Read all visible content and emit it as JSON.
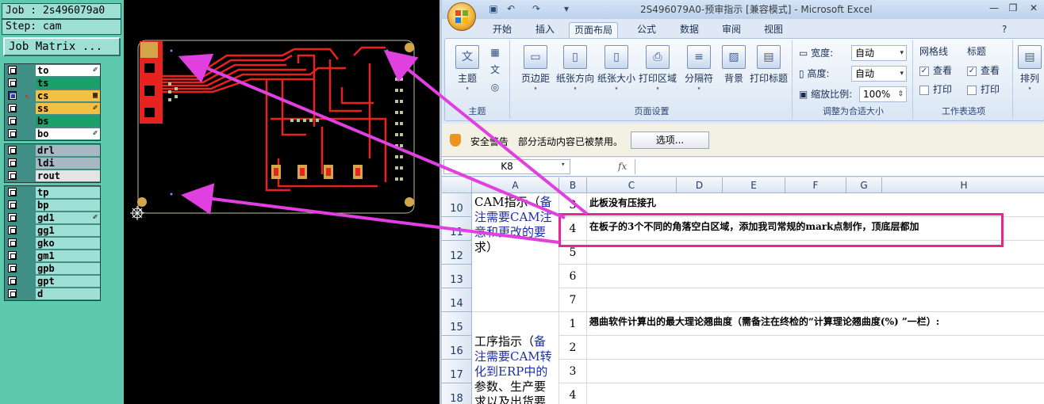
{
  "cam": {
    "job_label": "Job : 2s496079a0",
    "step_label": "Step: cam",
    "job_matrix_button": "Job Matrix ...",
    "board_layers": [
      {
        "name": "to",
        "color": "#ffffff",
        "mark": "✐"
      },
      {
        "name": "ts",
        "color": "#1aa06a",
        "mark": ""
      },
      {
        "name": "cs",
        "color": "#f4c043",
        "mark": "▦"
      },
      {
        "name": "ss",
        "color": "#f4c043",
        "mark": "✐"
      },
      {
        "name": "bs",
        "color": "#1aa06a",
        "mark": ""
      },
      {
        "name": "bo",
        "color": "#ffffff",
        "mark": "✐"
      }
    ],
    "drill_layers": [
      {
        "name": "drl",
        "color": "#a8b8c3",
        "mark": ""
      },
      {
        "name": "ldi",
        "color": "#a8b8c3",
        "mark": ""
      },
      {
        "name": "rout",
        "color": "#e4e4e4",
        "mark": ""
      }
    ],
    "misc_layers": [
      {
        "name": "tp",
        "color": "#9fe0d6",
        "mark": ""
      },
      {
        "name": "bp",
        "color": "#9fe0d6",
        "mark": ""
      },
      {
        "name": "gd1",
        "color": "#9fe0d6",
        "mark": "✐"
      },
      {
        "name": "gg1",
        "color": "#9fe0d6",
        "mark": ""
      },
      {
        "name": "gko",
        "color": "#9fe0d6",
        "mark": ""
      },
      {
        "name": "gm1",
        "color": "#9fe0d6",
        "mark": ""
      },
      {
        "name": "gpb",
        "color": "#9fe0d6",
        "mark": ""
      },
      {
        "name": "gpt",
        "color": "#9fe0d6",
        "mark": ""
      },
      {
        "name": "d",
        "color": "#9fe0d6",
        "mark": ""
      }
    ],
    "active_layer": "cs"
  },
  "excel": {
    "title": "2S496079A0-预审指示  [兼容模式] - Microsoft Excel",
    "tabs": [
      "开始",
      "插入",
      "页面布局",
      "公式",
      "数据",
      "审阅",
      "视图"
    ],
    "active_tab": "页面布局",
    "ribbon": {
      "theme_group": {
        "label": "主题",
        "theme_button": "主题"
      },
      "page_setup_group": {
        "label": "页面设置",
        "buttons": [
          "页边距",
          "纸张方向",
          "纸张大小",
          "打印区域",
          "分隔符",
          "背景",
          "打印标题"
        ]
      },
      "scale_group": {
        "label": "调整为合适大小",
        "width_label": "宽度:",
        "width_value": "自动",
        "height_label": "高度:",
        "height_value": "自动",
        "scale_label": "缩放比例:",
        "scale_value": "100%"
      },
      "sheet_options_group": {
        "label": "工作表选项",
        "gridlines_title": "网格线",
        "headings_title": "标题",
        "view_label": "查看",
        "print_label": "打印"
      },
      "arrange_group": {
        "label": "排列"
      }
    },
    "security": {
      "title": "安全警告",
      "message": "部分活动内容已被禁用。",
      "options_button": "选项..."
    },
    "name_box": "K8",
    "fx_label": "fx",
    "formula_value": "",
    "columns": [
      "A",
      "B",
      "C",
      "D",
      "E",
      "F",
      "G",
      "H"
    ],
    "rows": [
      {
        "num": "10",
        "b": "3",
        "c": "此板没有压接孔"
      },
      {
        "num": "11",
        "b": "4",
        "c": "在板子的3个不同的角落空白区域，添加我司常规的mark点制作，顶底层都加"
      },
      {
        "num": "12",
        "b": "5",
        "c": ""
      },
      {
        "num": "13",
        "b": "6",
        "c": ""
      },
      {
        "num": "14",
        "b": "7",
        "c": ""
      },
      {
        "num": "15",
        "b": "1",
        "c": "翘曲软件计算出的最大理论翘曲度（需备注在终检的“计算理论翘曲度(%) ”一栏）:"
      },
      {
        "num": "16",
        "b": "2",
        "c": ""
      },
      {
        "num": "17",
        "b": "3",
        "c": ""
      },
      {
        "num": "18",
        "b": "4",
        "c": ""
      }
    ],
    "merged_a1": {
      "black": "CAM指示（",
      "blue": "备注需要CAM注意和更改的要",
      "black2": "求）"
    },
    "merged_a2": {
      "black": "工序指示（",
      "blue": "备注需要CAM转化到ERP中的",
      "black2": "参数、生产要求以及出货要"
    }
  },
  "colors": {
    "highlight": "#e3288f",
    "annotation_arrow": "#e040e0",
    "pcb_copper": "#e8231f",
    "pcb_pad": "#d3a64a",
    "pcb_outline": "#b8c49a"
  }
}
